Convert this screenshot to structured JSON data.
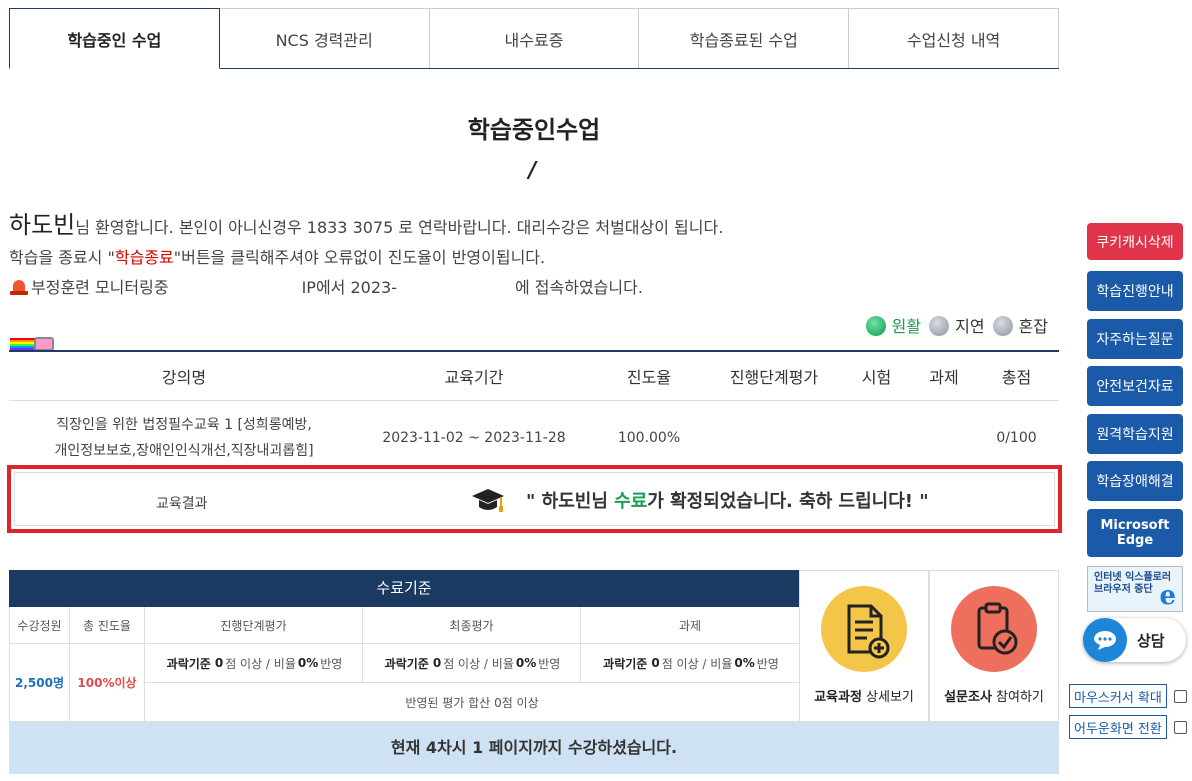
{
  "tabs": [
    "학습중인 수업",
    "NCS 경력관리",
    "내수료증",
    "학습종료된 수업",
    "수업신청 내역"
  ],
  "page_title": "학습중인수업",
  "slash": "/",
  "welcome": {
    "name": "하도빈",
    "line1_rest": "님 환영합니다. 본인이 아니신경우 1833 3075 로 연락바랍니다. 대리수강은 처벌대상이 됩니다.",
    "line2_pre": "학습을 종료시 \"",
    "line2_red": "학습종료",
    "line2_post": "\"버튼을 클릭해주셔야 오류없이 진도율이 반영이됩니다.",
    "line3_a": "부정훈련 모니터링중",
    "line3_b": "IP에서 2023-",
    "line3_c": "에 접속하였습니다."
  },
  "legend": {
    "smooth": "원활",
    "delay": "지연",
    "busy": "혼잡"
  },
  "course_table": {
    "headers": [
      "강의명",
      "교육기간",
      "진도율",
      "진행단계평가",
      "시험",
      "과제",
      "총점"
    ],
    "row": {
      "title_line1": "직장인을 위한 법정필수교육 1 [성희롱예방,",
      "title_line2": "개인정보보호,장애인인식개선,직장내괴롭힘]",
      "period": "2023-11-02 ~ 2023-11-28",
      "progress": "100.00%",
      "stage_eval": "",
      "exam": "",
      "assignment": "",
      "total": "0/100"
    }
  },
  "result": {
    "label": "교육결과",
    "msg_pre": "\" 하도빈님 ",
    "msg_green": "수료",
    "msg_post": "가 확정되었습니다. 축하 드립니다! \""
  },
  "criteria": {
    "title": "수료기준",
    "headers": [
      "수강정원",
      "총 진도율",
      "진행단계평가",
      "최종평가",
      "과제"
    ],
    "capacity": "2,500명",
    "total_progress": "100%이상",
    "eval_prefix": "과락기준",
    "eval_zero": "0",
    "eval_mid": "점 이상 / 비율",
    "eval_pct": "0%",
    "eval_suffix": "반영",
    "sum_text": "반영된 평가 합산 0점 이상"
  },
  "status_text": "현재 4차시 1 페이지까지 수강하셨습니다.",
  "buttons": {
    "course_detail_bold": "교육과정",
    "course_detail_rest": " 상세보기",
    "survey_bold": "설문조사",
    "survey_rest": " 참여하기"
  },
  "sidebar": {
    "items": [
      "쿠키캐시삭제",
      "학습진행안내",
      "자주하는질문",
      "안전보건자료",
      "원격학습지원",
      "학습장애해결",
      "Microsoft Edge"
    ],
    "ie_text": "인터넷 익스플로러\n브라우저 중단",
    "ie_sub": "e",
    "chat": "상담",
    "mouse_zoom": "마우스커서 확대",
    "dark_mode": "어두운화면 전환"
  },
  "colors": {
    "navy": "#1b3a62",
    "red": "#e0242b",
    "green": "#19a04a",
    "side_blue": "#1a5aa8",
    "side_red": "#e0344a"
  }
}
